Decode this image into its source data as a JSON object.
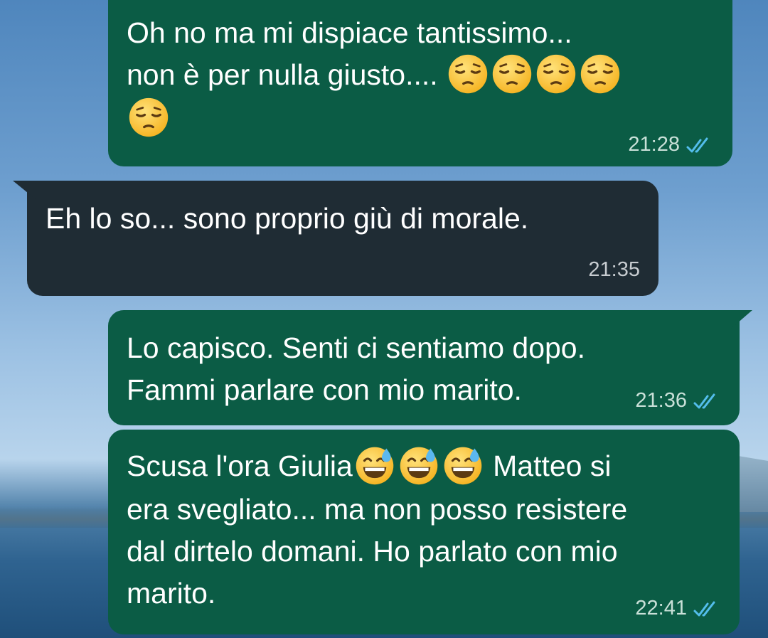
{
  "messages": [
    {
      "direction": "out",
      "line1": "Oh no ma mi dispiace tantissimo...",
      "line2": "non è per nulla giusto....",
      "emoji_pensive_count": 5,
      "time": "21:28",
      "status": "read"
    },
    {
      "direction": "in",
      "text": "Eh lo so... sono proprio giù di morale.",
      "time": "21:35"
    },
    {
      "direction": "out",
      "line1": "Lo capisco. Senti ci sentiamo dopo.",
      "line2": "Fammi parlare con mio marito.",
      "time": "21:36",
      "status": "read"
    },
    {
      "direction": "out",
      "part1": "Scusa l'ora Giulia",
      "part2": " Matteo si",
      "line2": "era svegliato... ma non posso resistere",
      "line3": "dal dirtelo domani. Ho parlato con mio",
      "line4": "marito.",
      "emoji_sweat_count": 3,
      "time": "22:41",
      "status": "read"
    }
  ],
  "icons": {
    "pensive": "pensive-face-emoji",
    "sweat_smile": "grinning-face-with-sweat-emoji",
    "read_receipt": "double-check-icon"
  },
  "colors": {
    "outgoing_bubble": "#0b5c45",
    "incoming_bubble": "#1f2c34",
    "read_ticks": "#53bdeb"
  }
}
